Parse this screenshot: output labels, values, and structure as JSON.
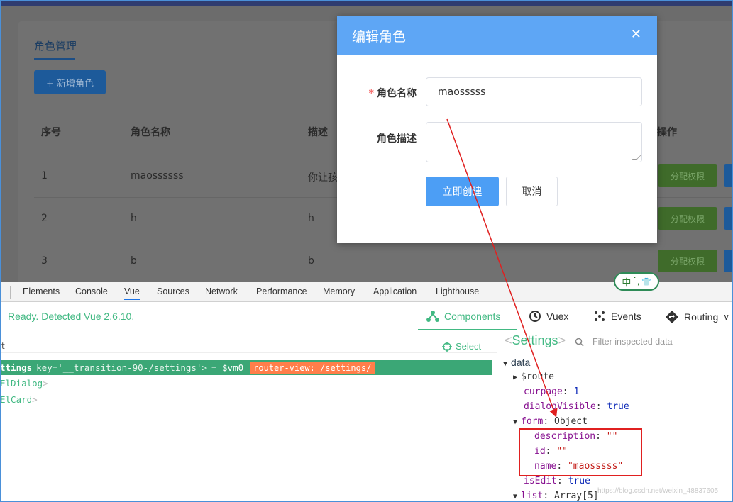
{
  "app": {
    "tab_title": "角色管理",
    "add_button": "+ 新增角色",
    "table": {
      "headers": [
        "序号",
        "角色名称",
        "描述",
        "操作"
      ],
      "rows": [
        {
          "index": "1",
          "name": "maossssss",
          "desc": "你让孩"
        },
        {
          "index": "2",
          "name": "h",
          "desc": "h"
        },
        {
          "index": "3",
          "name": "b",
          "desc": "b"
        }
      ],
      "perm_button": "分配权限"
    }
  },
  "dialog": {
    "title": "编辑角色",
    "close_icon": "✕",
    "required_mark": "*",
    "name_label": "角色名称",
    "name_value": "maosssss",
    "desc_label": "角色描述",
    "confirm_button": "立即创建",
    "cancel_button": "取消"
  },
  "devtools": {
    "tabs": [
      "Elements",
      "Console",
      "Vue",
      "Sources",
      "Network",
      "Performance",
      "Memory",
      "Application",
      "Lighthouse"
    ],
    "active_tab": "Vue",
    "vue": {
      "status": "Ready. Detected Vue 2.6.10.",
      "nav": [
        {
          "label": "Components",
          "icon": "components-icon"
        },
        {
          "label": "Vuex",
          "icon": "history-icon"
        },
        {
          "label": "Events",
          "icon": "events-icon"
        },
        {
          "label": "Routing",
          "icon": "routing-icon"
        }
      ],
      "routing_chevron": "∨",
      "select_label": "Select",
      "left_stub": "t",
      "selected_component": {
        "name": "ttings",
        "attr": "key='__transition-90-/settings'>",
        "vm": "= $vm0",
        "tag": "router-view: /settings/"
      },
      "children": [
        "ElDialog",
        "ElCard"
      ],
      "child_chevron": ">",
      "inspector": {
        "title": "Settings",
        "bracket_open": "<",
        "bracket_close": ">",
        "filter_placeholder": "Filter inspected data",
        "section": "data",
        "lines": {
          "route": "$route",
          "curpage_key": "curpage",
          "curpage_val": "1",
          "dialog_key": "dialogVisible",
          "dialog_val": "true",
          "form_key": "form",
          "form_val": "Object",
          "desc_key": "description",
          "desc_val": "\"\"",
          "id_key": "id",
          "id_val": "\"\"",
          "name_key": "name",
          "name_val": "\"maosssss\"",
          "isedit_key": "isEdit",
          "isedit_val": "true",
          "list_key": "list",
          "list_val": "Array[5]"
        }
      }
    }
  },
  "ime": {
    "text": "中",
    "dots": "˙,",
    "shirt": "👕"
  },
  "watermark": "https://blog.csdn.net/weixin_48837605",
  "colors": {
    "vue_green": "#42b983",
    "dialog_header": "#5ea6f5",
    "annotation_red": "#e02020"
  }
}
